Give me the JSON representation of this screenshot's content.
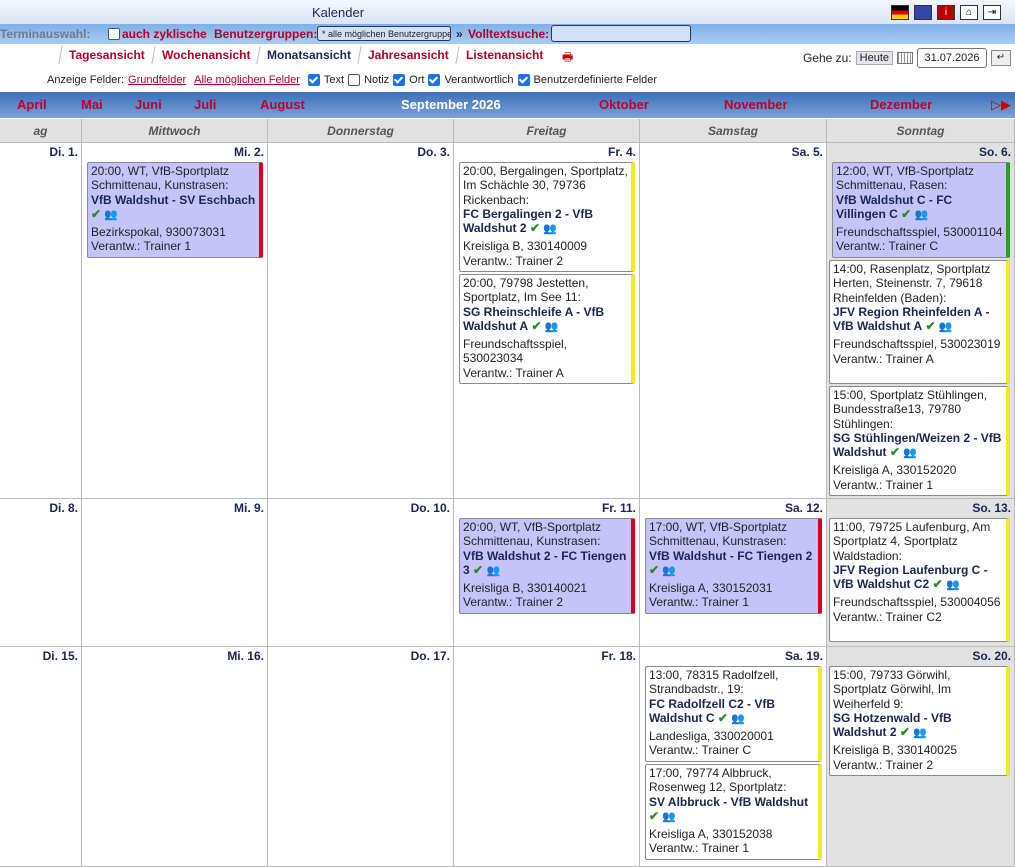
{
  "app": {
    "title": "Kalender"
  },
  "filters": {
    "terminauswahl": "Terminauswahl:",
    "zyklisch": "auch zyklische",
    "benutzergruppen": "Benutzergruppen:",
    "group_value": "* alle möglichen Benutzergruppen",
    "volltext_sep": "»",
    "volltext": "Volltextsuche:"
  },
  "tabs": [
    "Tagesansicht",
    "Wochenansicht",
    "Monatsansicht",
    "Jahresansicht",
    "Listenansicht"
  ],
  "goto": {
    "label": "Gehe zu:",
    "heute": "Heute",
    "date": "31.07.2026",
    "enter": "↵"
  },
  "fields": {
    "label": "Anzeige Felder:",
    "link1": "Grundfelder",
    "link2": "Alle möglichen Felder",
    "text": "Text",
    "notiz": "Notiz",
    "ort": "Ort",
    "verantwortlich": "Verantwortlich",
    "benutzer": "Benutzerdefinierte Felder"
  },
  "months": [
    "April",
    "Mai",
    "Juni",
    "Juli",
    "August",
    "September 2026",
    "Oktober",
    "November",
    "Dezember"
  ],
  "weekday_headers": [
    "ag",
    "Mittwoch",
    "Donnerstag",
    "Freitag",
    "Samstag",
    "Sonntag"
  ],
  "days": {
    "r1": [
      "Di. 1.",
      "Mi. 2.",
      "Do. 3.",
      "Fr. 4.",
      "Sa. 5.",
      "So. 6."
    ],
    "r2": [
      "Di. 8.",
      "Mi. 9.",
      "Do. 10.",
      "Fr. 11.",
      "Sa. 12.",
      "So. 13."
    ],
    "r3": [
      "Di. 15.",
      "Mi. 16.",
      "Do. 17.",
      "Fr. 18.",
      "Sa. 19.",
      "So. 20."
    ]
  },
  "events": {
    "e1": {
      "head": "20:00, WT, VfB-Sportplatz Schmittenau, Kunstrasen:",
      "teams": "VfB Waldshut - SV Eschbach",
      "league": "Bezirkspokal, 930073031",
      "resp": "Verantw.: Trainer 1"
    },
    "e2": {
      "head": "20:00, Bergalingen, Sportplatz, Im Schächle 30, 79736 Rickenbach:",
      "teams": "FC Bergalingen 2 - VfB Waldshut 2",
      "league": "Kreisliga B, 330140009",
      "resp": "Verantw.: Trainer 2"
    },
    "e3": {
      "head": "20:00, 79798 Jestetten, Sportplatz, Im See 11:",
      "teams": "SG Rheinschleife A - VfB Waldshut A",
      "league": "Freundschaftsspiel, 530023034",
      "resp": "Verantw.: Trainer A"
    },
    "e4": {
      "head": "12:00, WT, VfB-Sportplatz Schmittenau, Rasen:",
      "teams": "VfB Waldshut C - FC Villingen C",
      "league": "Freundschaftsspiel, 530001104",
      "resp": "Verantw.: Trainer C"
    },
    "e5": {
      "head": "14:00, Rasenplatz, Sportplatz Herten, Steinenstr. 7, 79618 Rheinfelden (Baden):",
      "teams": "JFV Region Rheinfelden A - VfB Waldshut A",
      "league": "Freundschaftsspiel, 530023019",
      "resp": "Verantw.: Trainer A"
    },
    "e6": {
      "head": "15:00, Sportplatz Stühlingen, Bundesstraße13, 79780 Stühlingen:",
      "teams": "SG Stühlingen/Weizen 2 - VfB Waldshut",
      "league": "Kreisliga A, 330152020",
      "resp": "Verantw.: Trainer 1"
    },
    "e7": {
      "head": "20:00, WT, VfB-Sportplatz Schmittenau, Kunstrasen:",
      "teams": "VfB Waldshut 2 - FC Tiengen 3",
      "league": "Kreisliga B, 330140021",
      "resp": "Verantw.: Trainer 2"
    },
    "e8": {
      "head": "17:00, WT, VfB-Sportplatz Schmittenau, Kunstrasen:",
      "teams": "VfB Waldshut - FC Tiengen 2",
      "league": "Kreisliga A, 330152031",
      "resp": "Verantw.: Trainer 1"
    },
    "e9": {
      "head": "11:00, 79725 Laufenburg, Am Sportplatz 4, Sportplatz Waldstadion:",
      "teams": "JFV Region Laufenburg C - VfB Waldshut C2",
      "league": "Freundschaftsspiel, 530004056",
      "resp": "Verantw.: Trainer C2"
    },
    "e10": {
      "head": "13:00, 78315 Radolfzell, Strandbadstr., 19:",
      "teams": "FC Radolfzell C2 - VfB Waldshut C",
      "league": "Landesliga, 330020001",
      "resp": "Verantw.: Trainer C"
    },
    "e11": {
      "head": "17:00, 79774 Albbruck, Rosenweg 12, Sportplatz:",
      "teams": "SV Albbruck - VfB Waldshut",
      "league": "Kreisliga A, 330152038",
      "resp": "Verantw.: Trainer 1"
    },
    "e12": {
      "head": "15:00, 79733 Görwihl, Sportplatz Görwihl, Im Weiherfeld 9:",
      "teams": "SG Hotzenwald - VfB Waldshut 2",
      "league": "Kreisliga B, 330140025",
      "resp": "Verantw.: Trainer 2"
    }
  },
  "icons": {
    "check": "✔",
    "group": "👥"
  }
}
